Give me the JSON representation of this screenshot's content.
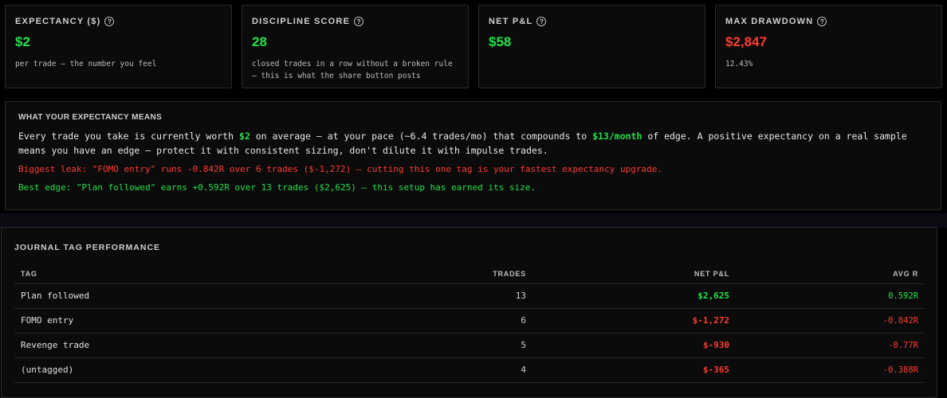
{
  "stats": [
    {
      "label": "EXPECTANCY ($)",
      "value": "$2",
      "tone": "green",
      "sub": "per trade — the number you feel"
    },
    {
      "label": "DISCIPLINE SCORE",
      "value": "28",
      "tone": "green",
      "sub": "closed trades in a row without a broken rule — this is what the share button posts"
    },
    {
      "label": "NET P&L",
      "value": "$58",
      "tone": "green",
      "sub": ""
    },
    {
      "label": "MAX DRAWDOWN",
      "value": "$2,847",
      "tone": "red",
      "sub": "12.43%"
    }
  ],
  "insight": {
    "title": "WHAT YOUR EXPECTANCY MEANS",
    "p1": "Every trade you take is currently worth ",
    "p1_value": "$2",
    "p2": " on average — at your pace (~6.4 trades/mo) that compounds to ",
    "p2_value": "$13/month",
    "p3": " of edge. A positive expectancy on a real sample means you have an edge — protect it with consistent sizing, don't dilute it with impulse trades.",
    "leak": "Biggest leak: \"FOMO entry\" runs -0.842R over 6 trades ($-1,272) — cutting this one tag is your fastest expectancy upgrade.",
    "edge": "Best edge: \"Plan followed\" earns +0.592R over 13 trades ($2,625) — this setup has earned its size."
  },
  "tags": {
    "title": "JOURNAL TAG PERFORMANCE",
    "columns": {
      "tag": "TAG",
      "trades": "TRADES",
      "pnl": "NET P&L",
      "avg_r": "AVG R"
    },
    "rows": [
      {
        "tag": "Plan followed",
        "trades": "13",
        "pnl": "$2,625",
        "avg_r": "0.592R",
        "tone": "green"
      },
      {
        "tag": "FOMO entry",
        "trades": "6",
        "pnl": "$-1,272",
        "avg_r": "-0.842R",
        "tone": "red"
      },
      {
        "tag": "Revenge trade",
        "trades": "5",
        "pnl": "$-930",
        "avg_r": "-0.77R",
        "tone": "red"
      },
      {
        "tag": "(untagged)",
        "trades": "4",
        "pnl": "$-365",
        "avg_r": "-0.388R",
        "tone": "red"
      }
    ]
  },
  "colors": {
    "positive": "#22e04a",
    "negative": "#ff3b30",
    "card_bg": "#0b0b0b",
    "border": "#2a2a2a"
  },
  "icons": {
    "info": "question-circle-icon"
  }
}
